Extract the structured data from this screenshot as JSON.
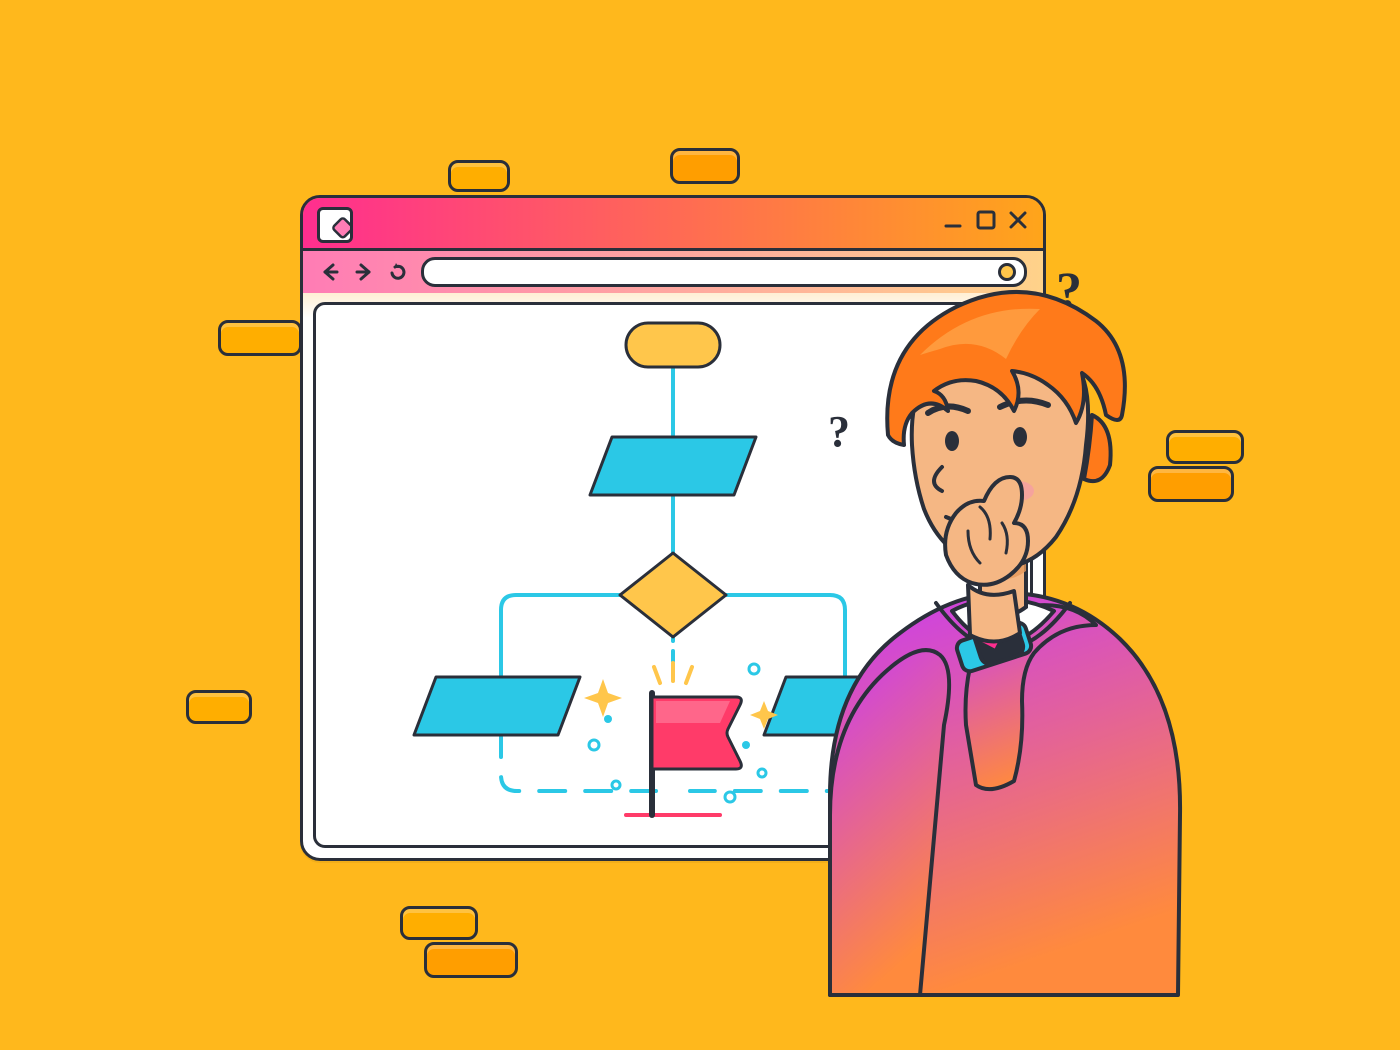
{
  "colors": {
    "bg": "#FFB81C",
    "pill_fill": "#FFAE00",
    "pill_fill2": "#FF9E00",
    "outline": "#2A2F3A",
    "titlebar_gradient_from": "#FF2E8F",
    "titlebar_gradient_to": "#FFA51A",
    "toolbar_gradient_from": "#FF7CB5",
    "toolbar_gradient_to": "#FFD28A",
    "addr_dot": "#FFC64B",
    "node_start": "#FFC64B",
    "node_process": "#2BC8E6",
    "node_decision": "#FFC64B",
    "flag_fill": "#FF3B69",
    "flag_highlight": "#FF6C8E",
    "sparkle": "#FFC64B",
    "connector": "#2BC8E6",
    "skin": "#F5B784",
    "skin_shadow": "#E6985B",
    "hair": "#FF7A1A",
    "hair_highlight": "#FF9A3D",
    "sweater_from": "#C93CF0",
    "sweater_to": "#FF8A3D",
    "tshirt": "#FFFFFF",
    "watch_body": "#2A2F3A",
    "watch_strap": "#2BC8E6",
    "watch_accent": "#FF2E8F"
  },
  "window_controls": {
    "minimize": "_",
    "maximize": "☐",
    "close": "✕"
  },
  "question_marks": {
    "q1": "?",
    "q2": "?"
  },
  "illustration_description": "A stylized illustration of a person with orange hair in a purple-to-orange gradient sweater, thinking (hand on chin) while looking at a browser window that displays a flowchart diagram. The flowchart has a start node, a process node, a decision diamond branching to two process nodes, and a red goal flag in the center with sparkles. The background is solid yellow with scattered small rounded-rectangle decorations. Two question marks float near the person's head."
}
